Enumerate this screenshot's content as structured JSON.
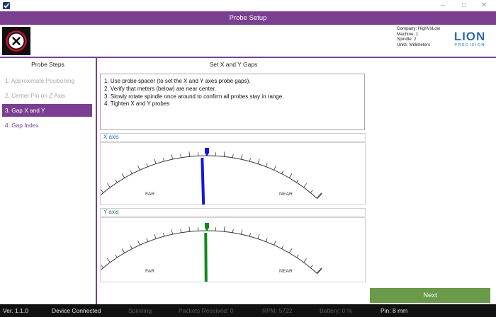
{
  "window": {
    "title": "Probe Setup",
    "controls": {
      "minimize": "–",
      "maximize": "□",
      "close": "✕"
    },
    "app_icon": "checkbox-icon"
  },
  "header": {
    "close_icon": "close-x-circle-icon",
    "company_lines": [
      "Company: HighVsLow",
      "Machine: 1",
      "Spindle: 2",
      "Units: Millimeters"
    ],
    "logo": {
      "word": "LION",
      "sub": "PRECISION"
    }
  },
  "sidebar": {
    "title": "Probe Steps",
    "steps": [
      {
        "label": "1. Approximate Positioning",
        "state": "done"
      },
      {
        "label": "2. Center Pin on Z Axis",
        "state": "done"
      },
      {
        "label": "3. Gap X and Y",
        "state": "active"
      },
      {
        "label": "4. Gap Index",
        "state": "pending"
      }
    ]
  },
  "main": {
    "title": "Set X and Y Gaps",
    "instructions": [
      "1. Use probe spacer (to set the X and Y axes probe gaps).",
      "2. Verify that meters (below) are near center.",
      "3. Slowly rotate spindle once around to confirm all probes stay in range.",
      "4. Tighten X and Y probes"
    ],
    "meters": [
      {
        "axis_label": "X axis",
        "far_label": "FAR",
        "near_label": "NEAR",
        "needle_value": 0.48,
        "target_value": 0.5,
        "needle_color": "#1414e6",
        "target_color": "#1414e6"
      },
      {
        "axis_label": "Y axis",
        "far_label": "FAR",
        "near_label": "NEAR",
        "needle_value": 0.495,
        "target_value": 0.5,
        "needle_color": "#0f8a1e",
        "target_color": "#0f8a1e"
      }
    ],
    "next_label": "Next"
  },
  "status": {
    "version": "Ver. 1.1.0",
    "connection": "Device Connected",
    "spin_state": "Spinning",
    "packets": "Packets Received:   0",
    "rpm": "RPM:   5722",
    "battery": "Battery:   0   %",
    "pin": "Pin: 8 mm"
  },
  "colors": {
    "accent": "#7b3f91",
    "next_button": "#6a9a4a",
    "logo": "#2b6cb8"
  }
}
